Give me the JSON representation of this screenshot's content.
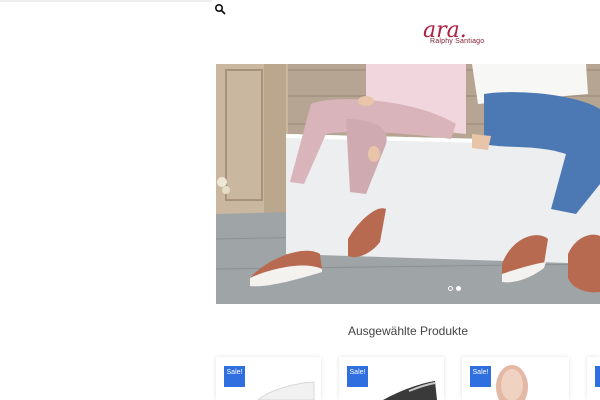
{
  "header": {
    "search_icon": "search-icon",
    "logo_text": "ara.",
    "logo_subtitle": "Ralphy Santiago"
  },
  "hero": {
    "slides_total": 2,
    "active_slide": 2
  },
  "featured": {
    "title": "Ausgewählte Produkte",
    "products": [
      {
        "badge": "Sale!"
      },
      {
        "badge": "Sale!"
      },
      {
        "badge": "Sale!"
      }
    ]
  },
  "colors": {
    "brand": "#b01f3f",
    "sale_badge": "#2f6fe0"
  }
}
